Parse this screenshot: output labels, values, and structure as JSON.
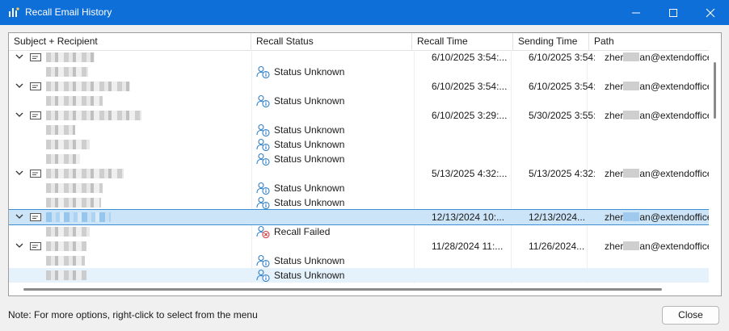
{
  "window": {
    "title": "Recall Email History"
  },
  "columns": [
    "Subject + Recipient",
    "Recall Status",
    "Recall Time",
    "Sending Time",
    "Path"
  ],
  "rows": [
    {
      "type": "group",
      "recall_time": "6/10/2025 3:54:...",
      "sending_time": "6/10/2025 3:54:...",
      "path_a": "zher",
      "path_b": "an@extendoffice"
    },
    {
      "type": "status",
      "status": "Status Unknown"
    },
    {
      "type": "group",
      "recall_time": "6/10/2025 3:54:...",
      "sending_time": "6/10/2025 3:54:...",
      "path_a": "zher",
      "path_b": "an@extendoffice"
    },
    {
      "type": "status",
      "status": "Status Unknown"
    },
    {
      "type": "group",
      "recall_time": "6/10/2025 3:29:...",
      "sending_time": "5/30/2025 3:55:...",
      "path_a": "zher",
      "path_b": "an@extendoffice"
    },
    {
      "type": "status",
      "status": "Status Unknown"
    },
    {
      "type": "status",
      "status": "Status Unknown"
    },
    {
      "type": "status",
      "status": "Status Unknown"
    },
    {
      "type": "group",
      "recall_time": "5/13/2025 4:32:...",
      "sending_time": "5/13/2025 4:32:...",
      "path_a": "zher",
      "path_b": "an@extendoffice"
    },
    {
      "type": "status",
      "status": "Status Unknown"
    },
    {
      "type": "status",
      "status": "Status Unknown"
    },
    {
      "type": "group",
      "recall_time": "12/13/2024 10:...",
      "sending_time": "12/13/2024...",
      "path_a": "zher",
      "path_b": "an@extendoffice"
    },
    {
      "type": "status",
      "status": "Recall Failed"
    },
    {
      "type": "group",
      "recall_time": "11/28/2024 11:...",
      "sending_time": "11/26/2024...",
      "path_a": "zher",
      "path_b": "an@extendoffice"
    },
    {
      "type": "status",
      "status": "Status Unknown"
    },
    {
      "type": "status",
      "status": "Status Unknown"
    }
  ],
  "footer": {
    "note": "Note: For more options, right-click to select from the menu",
    "close_label": "Close"
  },
  "colors": {
    "titlebar": "#0f6fd8",
    "selected_row": "#cce4f7",
    "status_icon": "#2f7fc8",
    "failed_icon": "#d93a3a"
  }
}
